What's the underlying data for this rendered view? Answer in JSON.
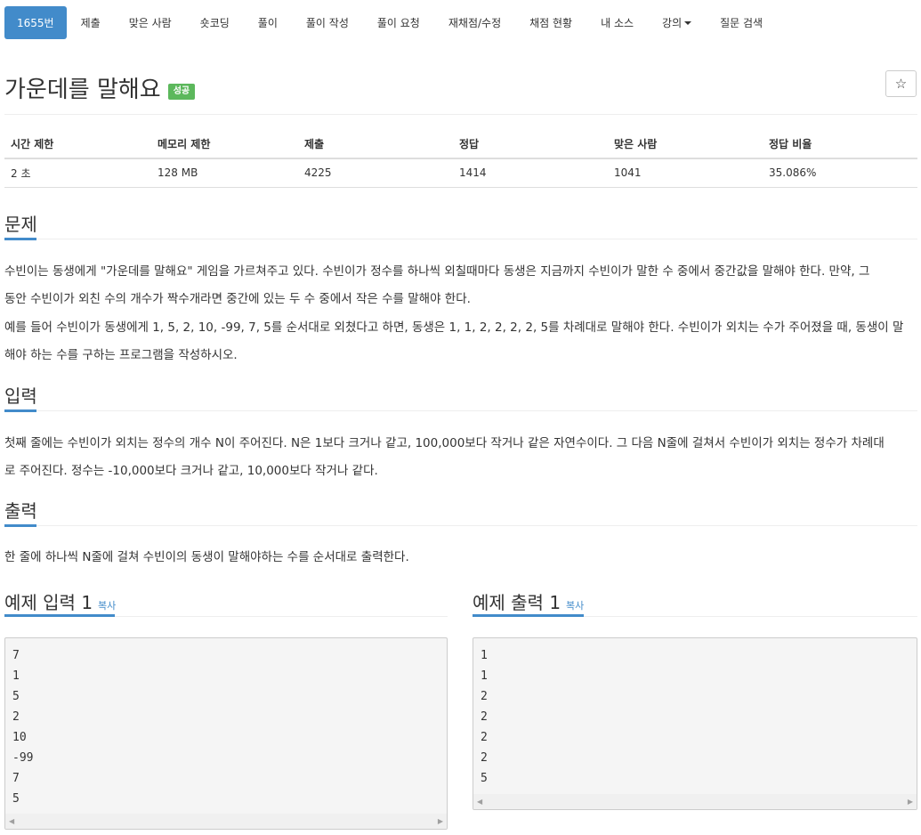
{
  "nav": {
    "items": [
      {
        "label": "1655번",
        "active": true
      },
      {
        "label": "제출"
      },
      {
        "label": "맞은 사람"
      },
      {
        "label": "숏코딩"
      },
      {
        "label": "풀이"
      },
      {
        "label": "풀이 작성"
      },
      {
        "label": "풀이 요청"
      },
      {
        "label": "재채점/수정"
      },
      {
        "label": "채점 현황"
      },
      {
        "label": "내 소스"
      },
      {
        "label": "강의",
        "dropdown": true
      },
      {
        "label": "질문 검색"
      }
    ]
  },
  "problem": {
    "title": "가운데를 말해요",
    "status_badge": "성공",
    "star_icon": "☆"
  },
  "info_table": {
    "headers": [
      "시간 제한",
      "메모리 제한",
      "제출",
      "정답",
      "맞은 사람",
      "정답 비율"
    ],
    "row": [
      "2 초",
      "128 MB",
      "4225",
      "1414",
      "1041",
      "35.086%"
    ]
  },
  "sections": {
    "description": {
      "heading": "문제",
      "paragraphs": [
        [
          "수빈이는 동생에게 \"가운데를 말해요\" 게임을 가르쳐주고 있다. 수빈이가 정수를 하나씩 외칠때마다 동생은 지금까지 수빈이가 말한 수 중에서 중간값을 말해야 한다. 만약, 그",
          "동안 수빈이가 외친 수의 개수가 짝수개라면 중간에 있는 두 수 중에서 작은 수를 말해야 한다."
        ],
        [
          "예를 들어 수빈이가 동생에게 1, 5, 2, 10, -99, 7, 5를 순서대로 외쳤다고 하면, 동생은 1, 1, 2, 2, 2, 2, 5를 차례대로 말해야 한다. 수빈이가 외치는 수가 주어졌을 때, 동생이 말",
          "해야 하는 수를 구하는 프로그램을 작성하시오."
        ]
      ]
    },
    "input": {
      "heading": "입력",
      "lines": [
        "첫째 줄에는 수빈이가 외치는 정수의 개수 N이 주어진다. N은 1보다 크거나 같고, 100,000보다 작거나 같은 자연수이다. 그 다음 N줄에 걸쳐서 수빈이가 외치는 정수가 차례대",
        "로 주어진다. 정수는 -10,000보다 크거나 같고, 10,000보다 작거나 같다."
      ]
    },
    "output": {
      "heading": "출력",
      "lines": [
        "한 줄에 하나씩 N줄에 걸쳐 수빈이의 동생이 말해야하는 수를 순서대로 출력한다."
      ]
    }
  },
  "samples": {
    "input": {
      "heading": "예제 입력 1",
      "copy_label": "복사",
      "lines": [
        "7",
        "1",
        "5",
        "2",
        "10",
        "-99",
        "7",
        "5"
      ]
    },
    "output": {
      "heading": "예제 출력 1",
      "copy_label": "복사",
      "lines": [
        "1",
        "1",
        "2",
        "2",
        "2",
        "2",
        "5"
      ]
    },
    "scroll_left_icon": "◀",
    "scroll_right_icon": "▶"
  }
}
